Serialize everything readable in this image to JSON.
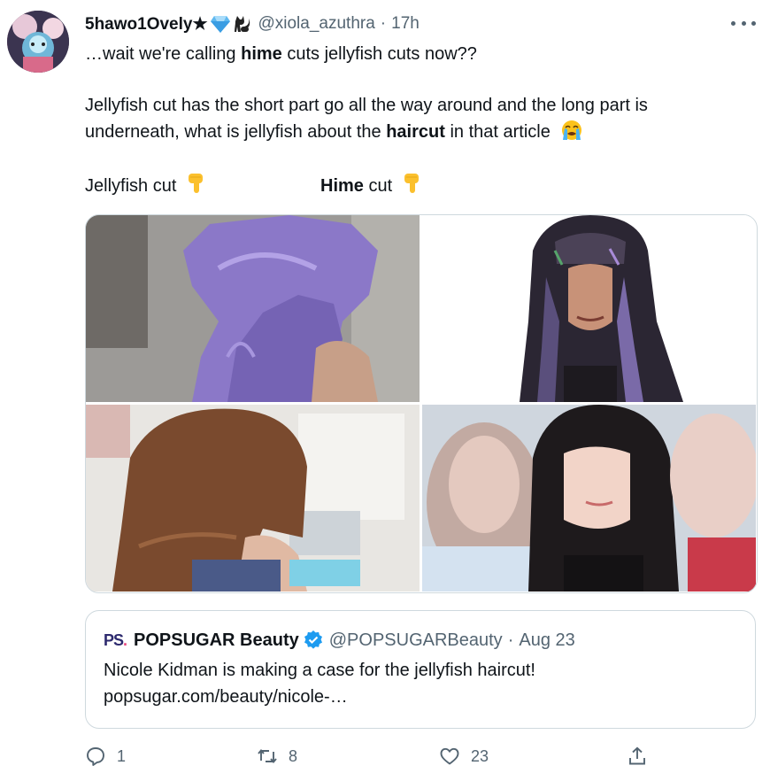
{
  "tweet": {
    "author_name": "5hawo1Ovely★",
    "handle": "@xiola_azuthra",
    "separator": "·",
    "time": "17h",
    "line1_pre": "…wait we're calling ",
    "line1_bold": "hime",
    "line1_post": " cuts jellyfish cuts now??",
    "line2": "Jellyfish cut has the short part go all the way around and the long part is",
    "line3_pre": "underneath, what is jellyfish about the ",
    "line3_bold": "haircut",
    "line3_post": " in that article",
    "label_left": "Jellyfish cut",
    "label_right_bold": "Hime",
    "label_right_post": " cut",
    "icons": {
      "name_emojis": [
        "gem-icon",
        "black-cat-icon"
      ],
      "crying_emoji": "loudly-crying-face-icon",
      "pointing_emoji": "backhand-index-pointing-down-icon"
    }
  },
  "media": {
    "images": [
      {
        "alt": "purple jellyfish cut back view",
        "accent": "#8b78c8"
      },
      {
        "alt": "hime cut with rainbow streaks",
        "accent": "#6d5e8f"
      },
      {
        "alt": "brown layered hair back view",
        "accent": "#7a4a2e"
      },
      {
        "alt": "long black hime cut",
        "accent": "#1e1a1c"
      }
    ]
  },
  "quote": {
    "logo_text_1": "PS",
    "logo_text_2": ".",
    "name": "POPSUGAR Beauty",
    "handle": "@POPSUGARBeauty",
    "separator": "·",
    "date": "Aug 23",
    "text": "Nicole Kidman is making a case for the jellyfish haircut!",
    "link": "popsugar.com/beauty/nicole-…"
  },
  "actions": {
    "reply_count": "1",
    "retweet_count": "8",
    "like_count": "23"
  },
  "colors": {
    "text": "#0f1419",
    "secondary": "#536471",
    "border": "#cfd9de",
    "verified": "#1d9bf0"
  }
}
